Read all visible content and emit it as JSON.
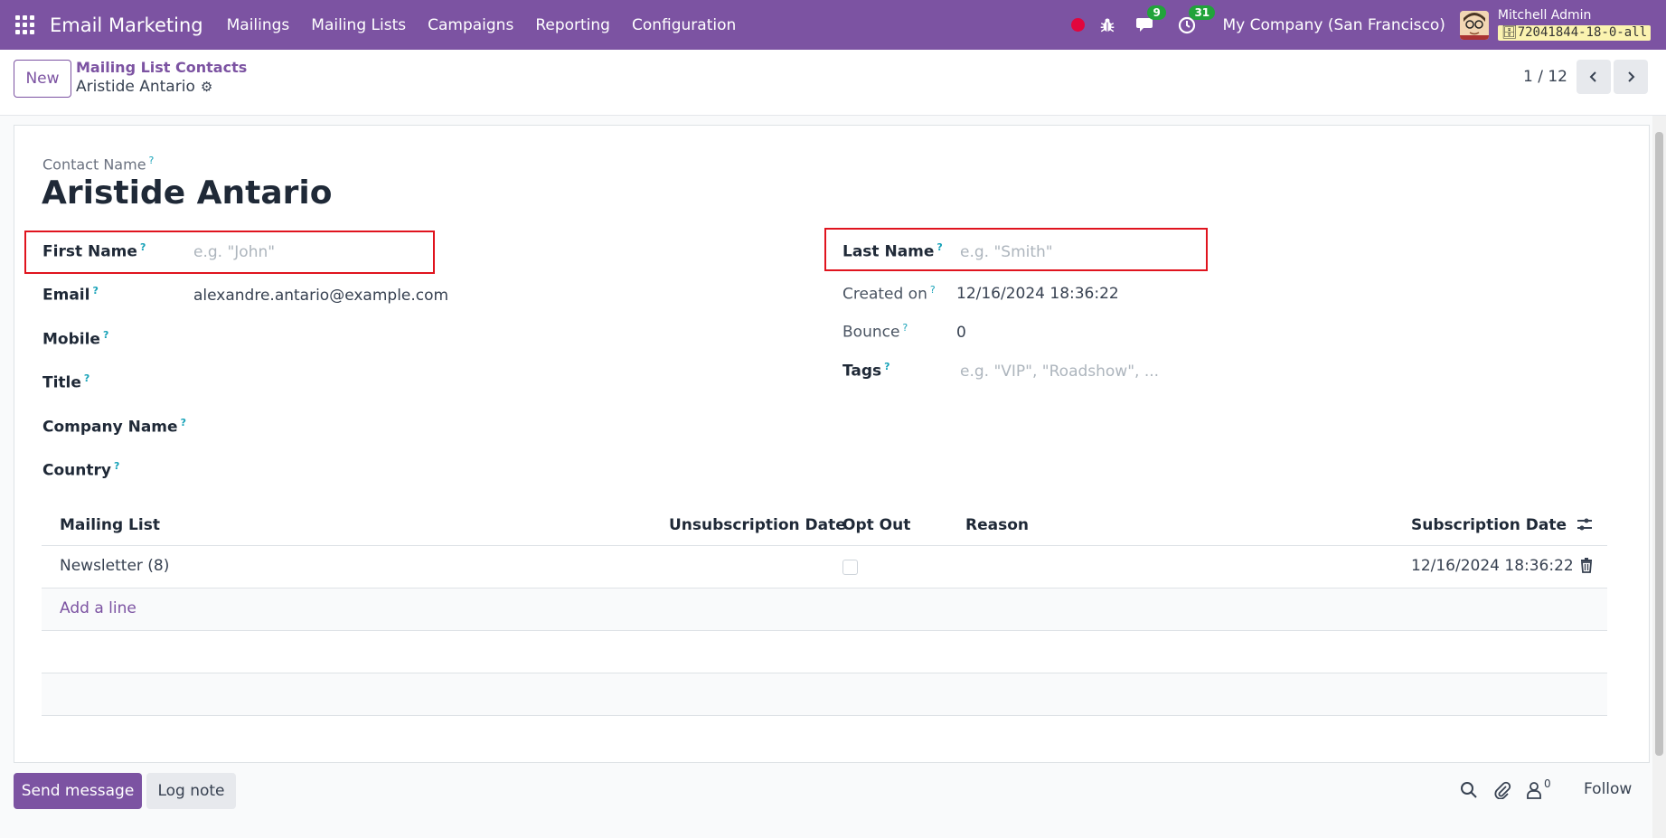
{
  "navbar": {
    "app_title": "Email Marketing",
    "menu": [
      "Mailings",
      "Mailing Lists",
      "Campaigns",
      "Reporting",
      "Configuration"
    ],
    "messages_count": "9",
    "activities_count": "31",
    "company": "My Company (San Francisco)",
    "user_name": "Mitchell Admin",
    "db_name": "72041844-18-0-all"
  },
  "breadcrumb": {
    "parent": "Mailing List Contacts",
    "current": "Aristide Antario"
  },
  "control": {
    "new_label": "New",
    "pager": "1 / 12"
  },
  "form": {
    "contact_name_label": "Contact Name",
    "contact_name": "Aristide Antario",
    "first_name_label": "First Name",
    "first_name_placeholder": "e.g. \"John\"",
    "last_name_label": "Last Name",
    "last_name_placeholder": "e.g. \"Smith\"",
    "email_label": "Email",
    "email_value": "alexandre.antario@example.com",
    "mobile_label": "Mobile",
    "title_label": "Title",
    "company_label": "Company Name",
    "country_label": "Country",
    "created_label": "Created on",
    "created_value": "12/16/2024 18:36:22",
    "bounce_label": "Bounce",
    "bounce_value": "0",
    "tags_label": "Tags",
    "tags_placeholder": "e.g. \"VIP\", \"Roadshow\", ..."
  },
  "table": {
    "headers": {
      "mailing_list": "Mailing List",
      "unsub_date": "Unsubscription Date",
      "opt_out": "Opt Out",
      "reason": "Reason",
      "sub_date": "Subscription Date"
    },
    "rows": [
      {
        "mailing_list": "Newsletter (8)",
        "opt_out": false,
        "sub_date": "12/16/2024 18:36:22"
      }
    ],
    "add_line": "Add a line"
  },
  "chatter": {
    "send_message": "Send message",
    "log_note": "Log note",
    "followers_count": "0",
    "follow": "Follow"
  },
  "colors": {
    "brand": "#7c53a2",
    "highlight_box": "#e0141e"
  }
}
